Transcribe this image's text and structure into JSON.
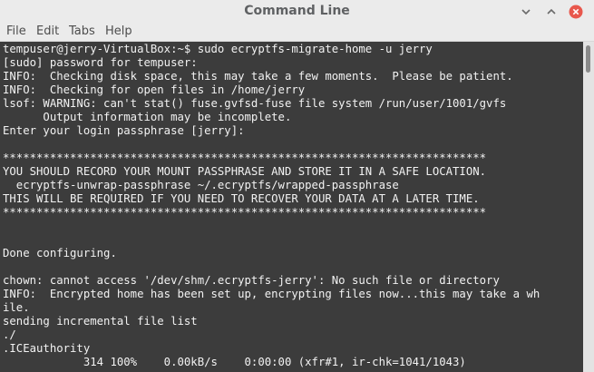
{
  "window": {
    "title": "Command Line",
    "controls": {
      "minimize_icon": "chevron-down-icon",
      "maximize_icon": "chevron-up-icon",
      "close_icon": "close-icon",
      "close_color": "#e8574c"
    }
  },
  "menu": {
    "items": [
      "File",
      "Edit",
      "Tabs",
      "Help"
    ]
  },
  "terminal": {
    "background": "#3c3c3c",
    "foreground": "#f2f2f2",
    "lines": [
      "tempuser@jerry-VirtualBox:~$ sudo ecryptfs-migrate-home -u jerry",
      "[sudo] password for tempuser:",
      "INFO:  Checking disk space, this may take a few moments.  Please be patient.",
      "INFO:  Checking for open files in /home/jerry",
      "lsof: WARNING: can't stat() fuse.gvfsd-fuse file system /run/user/1001/gvfs",
      "      Output information may be incomplete.",
      "Enter your login passphrase [jerry]:",
      "",
      "************************************************************************",
      "YOU SHOULD RECORD YOUR MOUNT PASSPHRASE AND STORE IT IN A SAFE LOCATION.",
      "  ecryptfs-unwrap-passphrase ~/.ecryptfs/wrapped-passphrase",
      "THIS WILL BE REQUIRED IF YOU NEED TO RECOVER YOUR DATA AT A LATER TIME.",
      "************************************************************************",
      "",
      "",
      "",
      "Done configuring.",
      "",
      "chown: cannot access '/dev/shm/.ecryptfs-jerry': No such file or directory",
      "INFO:  Encrypted home has been set up, encrypting files now...this may take a wh",
      "ile.",
      "sending incremental file list",
      "./",
      ".ICEauthority",
      "            314 100%    0.00kB/s    0:00:00 (xfr#1, ir-chk=1041/1043)"
    ]
  }
}
